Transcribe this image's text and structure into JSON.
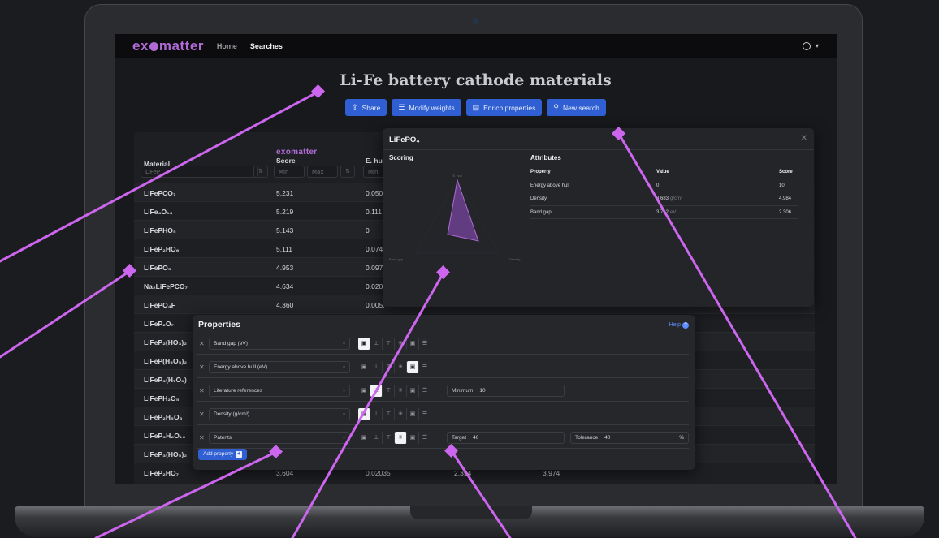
{
  "nav": {
    "brand": "exomatter",
    "links": [
      "Home",
      "Searches"
    ]
  },
  "page": {
    "title": "Li-Fe battery cathode materials"
  },
  "actions": [
    {
      "label": "Share",
      "icon": "share-icon"
    },
    {
      "label": "Modify weights",
      "icon": "sliders-icon"
    },
    {
      "label": "Enrich properties",
      "icon": "enrich-icon"
    },
    {
      "label": "New search",
      "icon": "search-icon"
    }
  ],
  "table": {
    "headers": {
      "material": "Material",
      "score_brand": "exomatter",
      "score": "Score",
      "ehull": "E. hu"
    },
    "filters": {
      "material_placeholder": "LiFeP",
      "min": "Min",
      "max": "Max"
    },
    "rows": [
      {
        "material": "LiFePCO₇",
        "score": "5.231",
        "ehull": "0.050",
        "c4": "",
        "c5": ""
      },
      {
        "material": "LiFe₄O₁₃",
        "score": "5.219",
        "ehull": "0.111",
        "c4": "",
        "c5": ""
      },
      {
        "material": "LiFePHO₅",
        "score": "5.143",
        "ehull": "0",
        "c4": "",
        "c5": ""
      },
      {
        "material": "LiFeP₂HO₆",
        "score": "5.111",
        "ehull": "0.074",
        "c4": "",
        "c5": ""
      },
      {
        "material": "LiFePO₅",
        "score": "4.953",
        "ehull": "0.097",
        "c4": "",
        "c5": ""
      },
      {
        "material": "Na₂LiFePCO₇",
        "score": "4.634",
        "ehull": "0.020",
        "c4": "",
        "c5": ""
      },
      {
        "material": "LiFePO₄F",
        "score": "4.360",
        "ehull": "0.005.",
        "c4": "",
        "c5": ""
      },
      {
        "material": "LiFeP₂O₇",
        "score": "",
        "ehull": "",
        "c4": "",
        "c5": ""
      },
      {
        "material": "LiFeP₂(HO₃)₂",
        "score": "",
        "ehull": "",
        "c4": "",
        "c5": ""
      },
      {
        "material": "LiFeP(H₅O₅)₂",
        "score": "",
        "ehull": "",
        "c4": "",
        "c5": ""
      },
      {
        "material": "LiFeP₃(H₇O₈)",
        "score": "",
        "ehull": "",
        "c4": "",
        "c5": ""
      },
      {
        "material": "LiFePH₂O₅",
        "score": "",
        "ehull": "",
        "c4": "",
        "c5": ""
      },
      {
        "material": "LiFeP₂H₅O₃",
        "score": "",
        "ehull": "",
        "c4": "",
        "c5": ""
      },
      {
        "material": "LiFeP₃H₈O₁₃",
        "score": "",
        "ehull": "",
        "c4": "",
        "c5": ""
      },
      {
        "material": "LiFeP₃(HO₅)₂",
        "score": "",
        "ehull": "",
        "c4": "",
        "c5": ""
      },
      {
        "material": "LiFeP₂HO₇",
        "score": "3.604",
        "ehull": "0.02035",
        "c4": "2.394",
        "c5": "3.974"
      }
    ]
  },
  "detail": {
    "title": "LiFePO₄",
    "scoring_label": "Scoring",
    "attributes_label": "Attributes",
    "radar_axes": {
      "top": "E. hull",
      "left": "Band gap",
      "right": "Density"
    },
    "radar_levels": {
      "ehull": 1.0,
      "bandgap": 0.23,
      "density": 0.5
    },
    "columns": {
      "property": "Property",
      "value": "Value",
      "score": "Score"
    },
    "attributes": [
      {
        "property": "Energy above hull",
        "value": "0",
        "unit": "",
        "score": "10"
      },
      {
        "property": "Density",
        "value": "3.683",
        "unit": "g/cm³",
        "score": "4.984"
      },
      {
        "property": "Band gap",
        "value": "3.712",
        "unit": "eV",
        "score": "2.306"
      }
    ]
  },
  "properties": {
    "title": "Properties",
    "help": "Help",
    "add_label": "Add property",
    "items": [
      {
        "name": "Band gap (eV)",
        "active_mode": 0
      },
      {
        "name": "Energy above hull (eV)",
        "active_mode": 4
      },
      {
        "name": "Literature references",
        "active_mode": 1,
        "param1_label": "Minimum",
        "param1_value": "10"
      },
      {
        "name": "Density (g/cm³)",
        "active_mode": 0
      },
      {
        "name": "Patents",
        "active_mode": 3,
        "param1_label": "Target",
        "param1_value": "40",
        "param2_label": "Tolerance",
        "param2_value": "40",
        "param2_unit": "%"
      }
    ]
  },
  "colors": {
    "accent": "#b06ad6",
    "button": "#2f5fd3",
    "callout": "#cc66ee"
  }
}
